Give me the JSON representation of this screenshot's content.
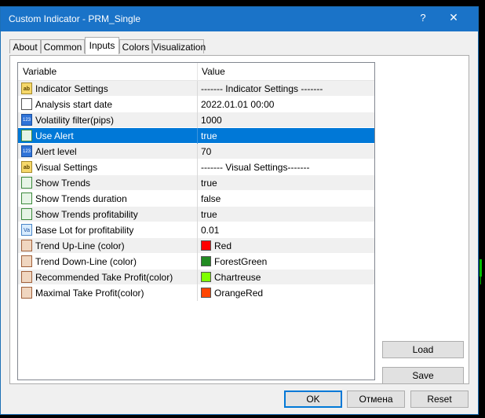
{
  "window": {
    "title": "Custom Indicator - PRM_Single",
    "help_glyph": "?",
    "close_glyph": "✕"
  },
  "tabs": [
    {
      "label": "About"
    },
    {
      "label": "Common"
    },
    {
      "label": "Inputs",
      "active": true
    },
    {
      "label": "Colors"
    },
    {
      "label": "Visualization"
    }
  ],
  "grid": {
    "columns": {
      "variable": "Variable",
      "value": "Value"
    },
    "rows": [
      {
        "icon": "ab-string-icon",
        "icon_text": "ab",
        "name": "Indicator Settings",
        "value": "------- Indicator Settings -------"
      },
      {
        "icon": "datetime-icon",
        "icon_text": "",
        "name": "Analysis start date",
        "value": "2022.01.01 00:00"
      },
      {
        "icon": "integer-icon",
        "icon_text": "123",
        "name": "Volatility filter(pips)",
        "value": "1000"
      },
      {
        "icon": "boolean-icon",
        "icon_text": "",
        "name": "Use Alert",
        "value": "true",
        "selected": true
      },
      {
        "icon": "integer-icon",
        "icon_text": "123",
        "name": "Alert level",
        "value": "70"
      },
      {
        "icon": "ab-string-icon",
        "icon_text": "ab",
        "name": "Visual Settings",
        "value": "------- Visual Settings-------"
      },
      {
        "icon": "boolean-icon",
        "icon_text": "",
        "name": "Show Trends",
        "value": "true"
      },
      {
        "icon": "boolean-icon",
        "icon_text": "",
        "name": "Show Trends duration",
        "value": "false"
      },
      {
        "icon": "boolean-icon",
        "icon_text": "",
        "name": "Show Trends profitability",
        "value": "true"
      },
      {
        "icon": "double-icon",
        "icon_text": "Va",
        "name": "Base Lot for profitability",
        "value": "0.01"
      },
      {
        "icon": "color-icon",
        "icon_text": "",
        "name": "Trend Up-Line (color)",
        "value": "Red",
        "swatch": "#ff0000"
      },
      {
        "icon": "color-icon",
        "icon_text": "",
        "name": "Trend Down-Line (color)",
        "value": "ForestGreen",
        "swatch": "#228b22"
      },
      {
        "icon": "color-icon",
        "icon_text": "",
        "name": "Recommended Take Profit(color)",
        "value": "Chartreuse",
        "swatch": "#7fff00"
      },
      {
        "icon": "color-icon",
        "icon_text": "",
        "name": "Maximal Take Profit(color)",
        "value": "OrangeRed",
        "swatch": "#ff4500"
      }
    ]
  },
  "side_buttons": {
    "load": "Load",
    "save": "Save"
  },
  "footer_buttons": {
    "ok": "OK",
    "cancel": "Отмена",
    "reset": "Reset"
  },
  "colors": {
    "title_bar": "#1a73c8",
    "selection": "#0078d7"
  }
}
